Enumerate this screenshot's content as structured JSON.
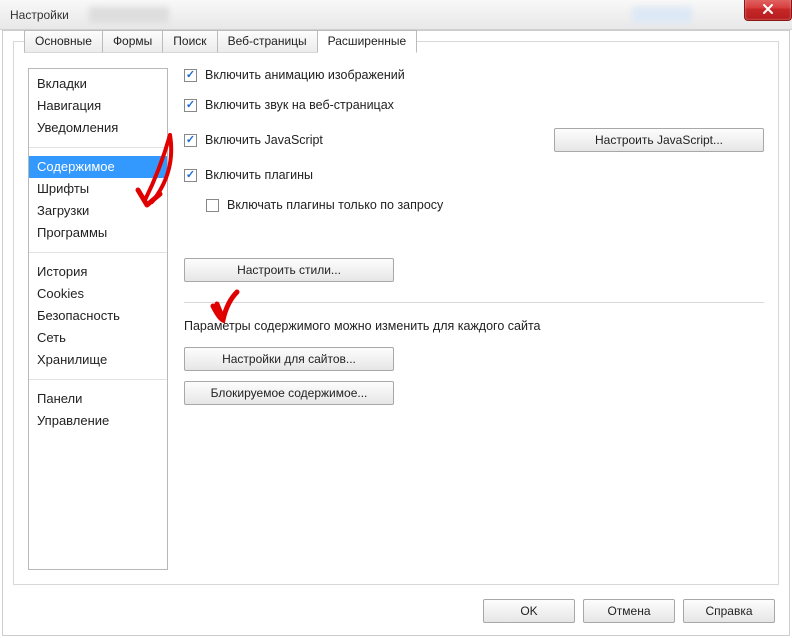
{
  "window": {
    "title": "Настройки"
  },
  "tabs": [
    {
      "label": "Основные",
      "active": false
    },
    {
      "label": "Формы",
      "active": false
    },
    {
      "label": "Поиск",
      "active": false
    },
    {
      "label": "Веб-страницы",
      "active": false
    },
    {
      "label": "Расширенные",
      "active": true
    }
  ],
  "sidebar": {
    "groups": [
      [
        "Вкладки",
        "Навигация",
        "Уведомления"
      ],
      [
        "Содержимое",
        "Шрифты",
        "Загрузки",
        "Программы"
      ],
      [
        "История",
        "Cookies",
        "Безопасность",
        "Сеть",
        "Хранилище"
      ],
      [
        "Панели",
        "Управление"
      ]
    ],
    "selected": "Содержимое"
  },
  "content": {
    "cb_anim": "Включить анимацию изображений",
    "cb_sound": "Включить звук на веб-страницах",
    "cb_js": "Включить JavaScript",
    "btn_js": "Настроить JavaScript...",
    "cb_plugins": "Включить плагины",
    "cb_plugins_ondemand": "Включать плагины только по запросу",
    "btn_styles": "Настроить стили...",
    "para_sites": "Параметры содержимого можно изменить для каждого сайта",
    "btn_sites": "Настройки для сайтов...",
    "btn_blocked": "Блокируемое содержимое..."
  },
  "footer": {
    "ok": "OK",
    "cancel": "Отмена",
    "help": "Справка"
  }
}
